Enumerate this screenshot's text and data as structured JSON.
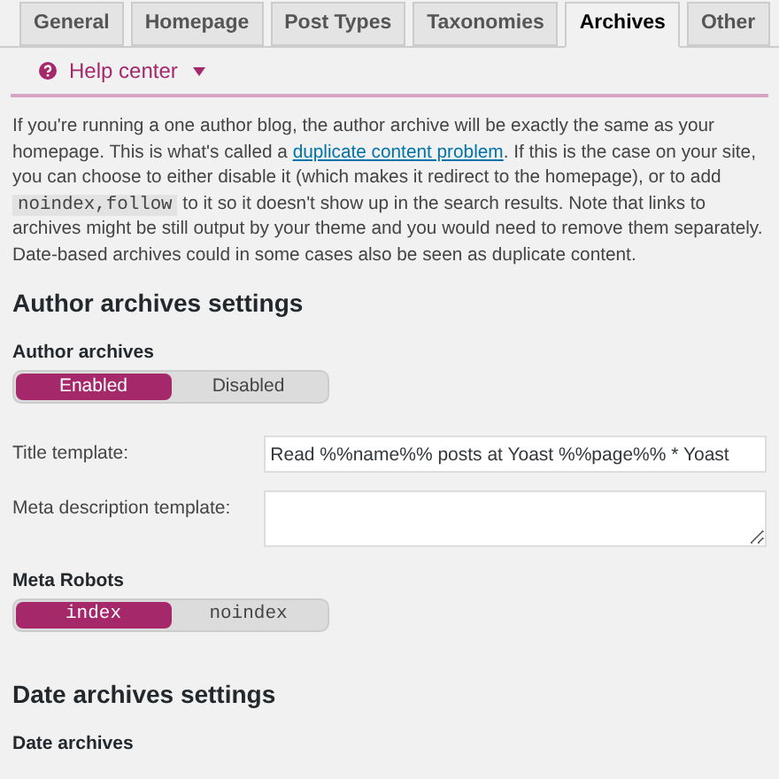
{
  "tabs": [
    {
      "label": "General",
      "selected": false
    },
    {
      "label": "Homepage",
      "selected": false
    },
    {
      "label": "Post Types",
      "selected": false
    },
    {
      "label": "Taxonomies",
      "selected": false
    },
    {
      "label": "Archives",
      "selected": true
    },
    {
      "label": "Other",
      "selected": false
    }
  ],
  "help_center": {
    "label": "Help center",
    "expanded": false
  },
  "intro": [
    {
      "kind": "text",
      "text": "If you're running a one author blog, the author archive will be exactly the same as your homepage. This is what's called a "
    },
    {
      "kind": "link",
      "text": "duplicate content problem"
    },
    {
      "kind": "text",
      "text": ". If this is the case on your site, you can choose to either disable it (which makes it redirect to the homepage), or to add "
    },
    {
      "kind": "code",
      "text": "noindex,follow"
    },
    {
      "kind": "text",
      "text": " to it so it doesn't show up in the search results. Note that links to archives might be still output by your theme and you would need to remove them separately. Date-based archives could in some cases also be seen as duplicate content."
    }
  ],
  "sections": [
    {
      "heading": "Author archives settings",
      "fields": [
        {
          "kind": "toggle",
          "label": "Author archives",
          "mono": false,
          "options": [
            {
              "label": "Enabled",
              "selected": true
            },
            {
              "label": "Disabled",
              "selected": false
            }
          ]
        },
        {
          "kind": "text",
          "label": "Title template:",
          "value": "Read %%name%% posts at Yoast %%page%% * Yoast"
        },
        {
          "kind": "textarea",
          "label": "Meta description template:"
        },
        {
          "kind": "toggle",
          "label": "Meta Robots",
          "mono": true,
          "options": [
            {
              "label": "index",
              "selected": true
            },
            {
              "label": "noindex",
              "selected": false
            }
          ]
        }
      ]
    },
    {
      "heading": "Date archives settings",
      "fields": [
        {
          "kind": "label",
          "label": "Date archives"
        }
      ]
    }
  ]
}
